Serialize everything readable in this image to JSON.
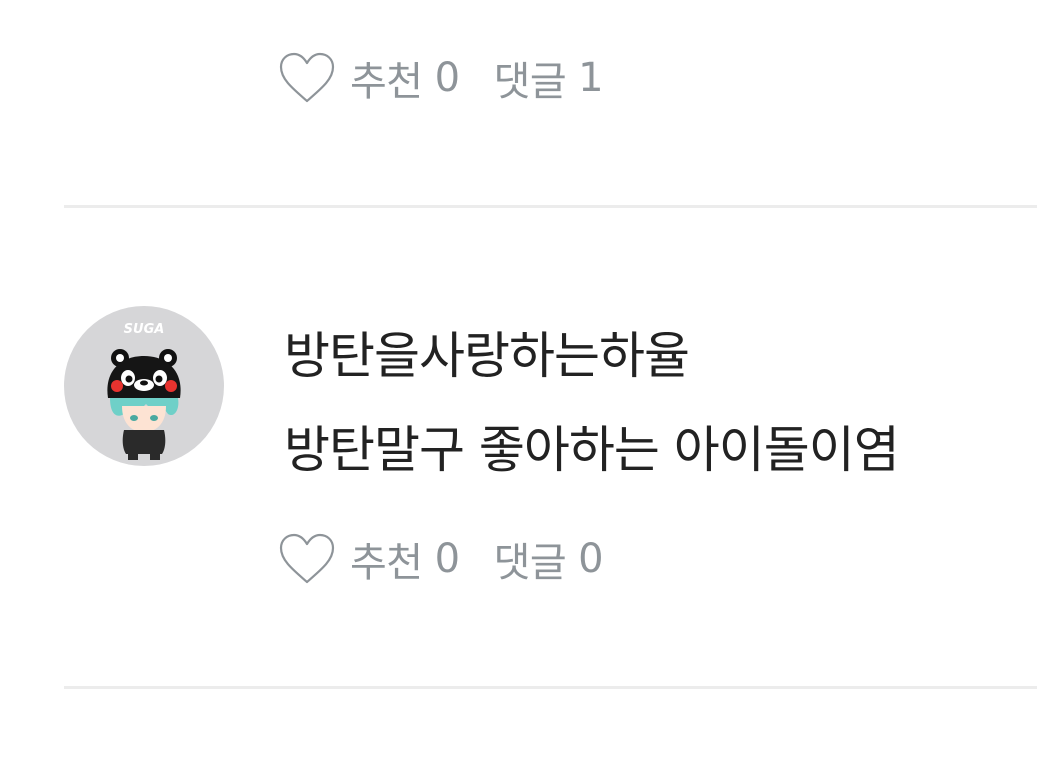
{
  "comments_top": {
    "like_label": "추천",
    "like_count": "0",
    "reply_label": "댓글",
    "reply_count": "1"
  },
  "comment": {
    "author": "방탄을사랑하는하율",
    "avatar_text": "SUGA",
    "text": "방탄말구 좋아하는 아이돌이염",
    "like_label": "추천",
    "like_count": "0",
    "reply_label": "댓글",
    "reply_count": "0"
  },
  "icons": {
    "like": "heart-outline-icon"
  },
  "colors": {
    "text_primary": "#222222",
    "text_muted": "#8e9499",
    "divider": "#ececec",
    "avatar_bg": "#d6d6d8"
  }
}
